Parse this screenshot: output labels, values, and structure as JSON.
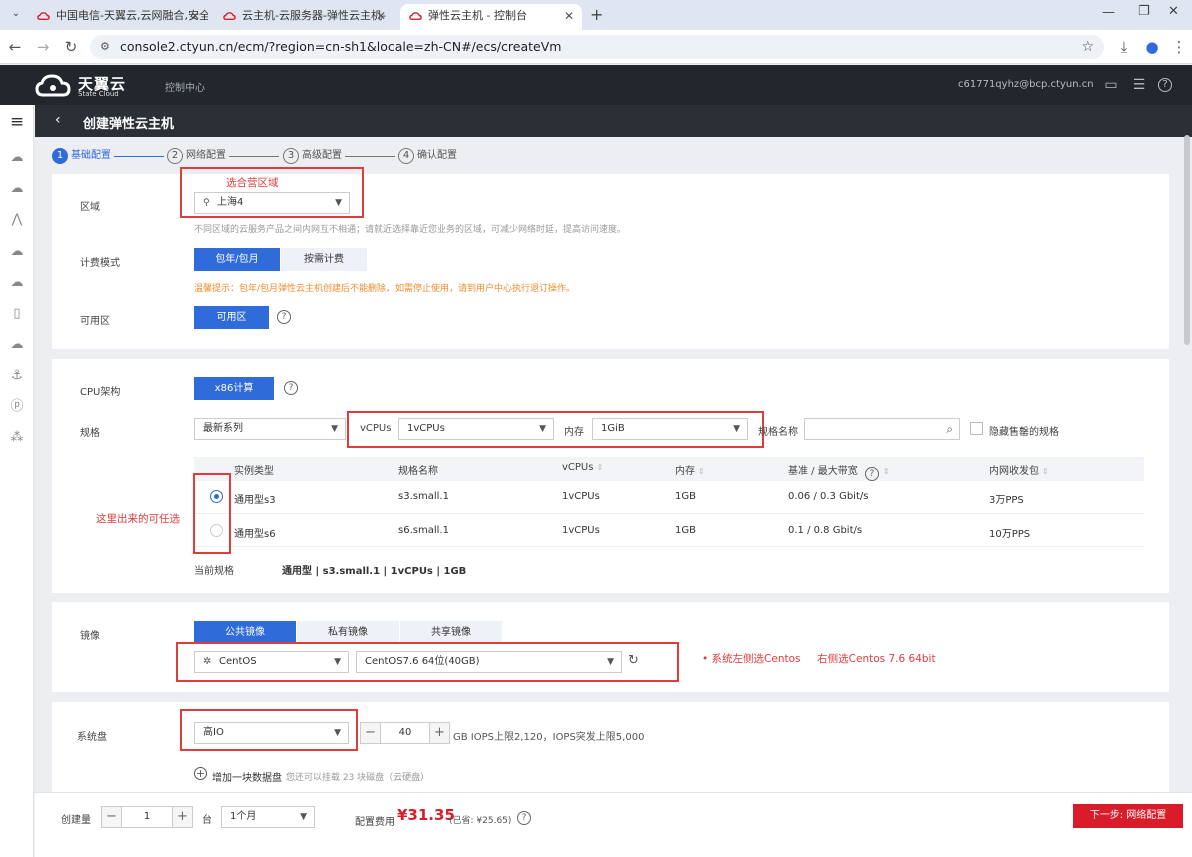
{
  "browser": {
    "tabs": [
      {
        "title": "中国电信-天翼云,云网融合,安全"
      },
      {
        "title": "云主机-云服务器-弹性云主机-"
      },
      {
        "title": "弹性云主机 - 控制台"
      }
    ],
    "url": "console2.ctyun.cn/ecm/?region=cn-sh1&locale=zh-CN#/ecs/createVm"
  },
  "header": {
    "logo_text": "天翼云",
    "logo_sub": "State Cloud",
    "console_link": "控制中心",
    "user_email": "c61771qyhz@bcp.ctyun.cn"
  },
  "page": {
    "title": "创建弹性云主机"
  },
  "steps": [
    {
      "num": "1",
      "label": "基础配置"
    },
    {
      "num": "2",
      "label": "网络配置"
    },
    {
      "num": "3",
      "label": "高级配置"
    },
    {
      "num": "4",
      "label": "确认配置"
    }
  ],
  "region": {
    "label": "区域",
    "value": "上海4",
    "hint": "不同区域的云服务产品之间内网互不相通；请就近选择靠近您业务的区域，可减少网络时延，提高访问速度。",
    "annotation": "选合营区域"
  },
  "billing": {
    "label": "计费模式",
    "options": [
      "包年/包月",
      "按需计费"
    ],
    "warning": "温馨提示：包年/包月弹性云主机创建后不能删除，如需停止使用，请到用户中心执行退订操作。"
  },
  "zone": {
    "label": "可用区",
    "button": "可用区"
  },
  "cpu": {
    "label": "CPU架构",
    "button": "x86计算"
  },
  "spec": {
    "label": "规格",
    "series": "最新系列",
    "vcpu_label": "vCPUs",
    "vcpu_value": "1vCPUs",
    "mem_label": "内存",
    "mem_value": "1GiB",
    "name_label": "规格名称",
    "name_placeholder": "",
    "hide_soldout": "隐藏售罄的规格",
    "columns": [
      "实例类型",
      "规格名称",
      "vCPUs",
      "内存",
      "基准 / 最大带宽",
      "内网收发包"
    ],
    "rows": [
      {
        "type": "通用型s3",
        "name": "s3.small.1",
        "vcpus": "1vCPUs",
        "mem": "1GB",
        "bw": "0.06 / 0.3 Gbit/s",
        "pps": "3万PPS",
        "selected": true
      },
      {
        "type": "通用型s6",
        "name": "s6.small.1",
        "vcpus": "1vCPUs",
        "mem": "1GB",
        "bw": "0.1 / 0.8 Gbit/s",
        "pps": "10万PPS",
        "selected": false
      }
    ],
    "current_label": "当前规格",
    "current_value": "通用型 | s3.small.1 | 1vCPUs | 1GB",
    "annotation": "这里出来的可任选"
  },
  "image": {
    "label": "镜像",
    "tabs": [
      "公共镜像",
      "私有镜像",
      "共享镜像"
    ],
    "os": "CentOS",
    "version": "CentOS7.6 64位(40GB)",
    "annotation": "• 系统左侧选Centos     右侧选Centos 7.6 64bit"
  },
  "disk": {
    "label": "系统盘",
    "type": "高IO",
    "size": "40",
    "iops": "GB IOPS上限2,120，IOPS突发上限5,000",
    "add_label": "增加一块数据盘",
    "add_hint": "您还可以挂载 23 块磁盘（云硬盘）"
  },
  "footer": {
    "qty_label": "创建量",
    "qty": "1",
    "unit": "台",
    "duration": "1个月",
    "price_label": "配置费用",
    "price": "¥31.35",
    "saved": "(已省: ¥25.65)",
    "next": "下一步: 网络配置"
  },
  "colors": {
    "accent": "#2f6bd9",
    "brand_red": "#d91c2a",
    "annotation": "#e03c3c"
  }
}
